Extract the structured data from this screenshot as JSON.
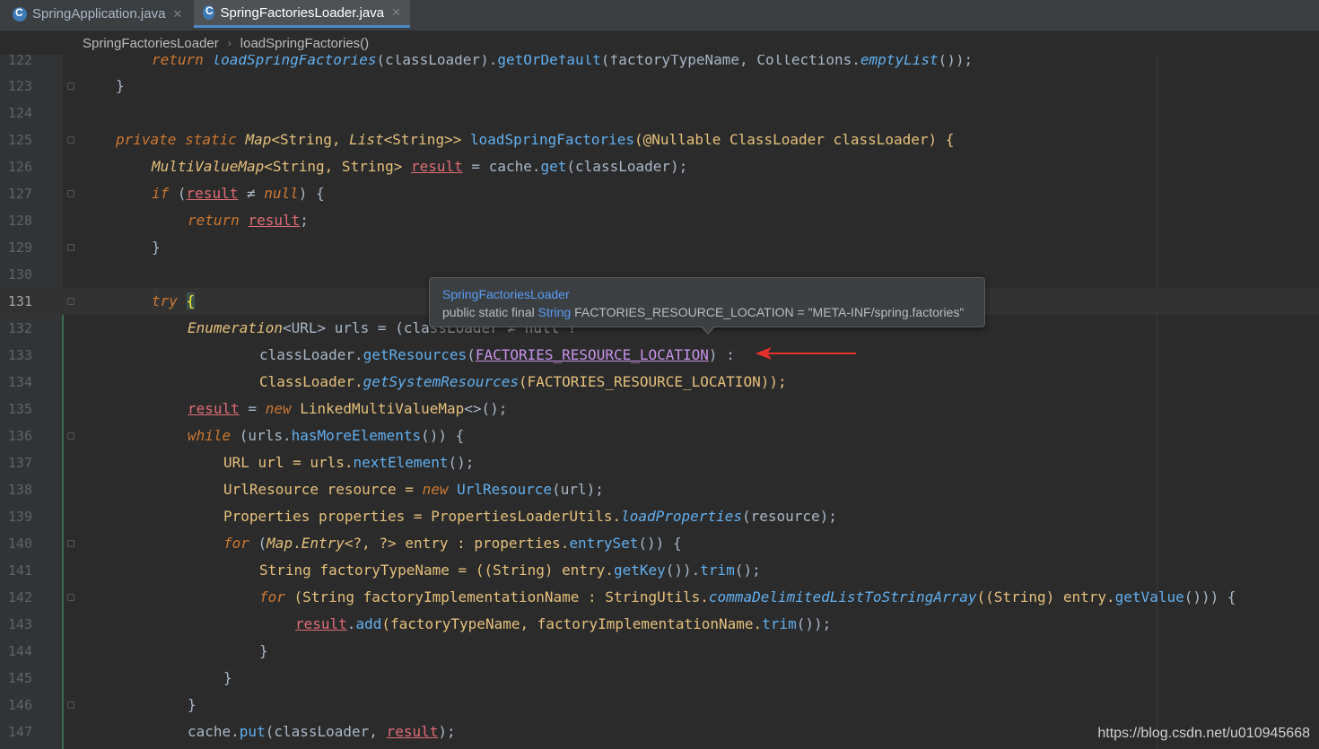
{
  "tabs": [
    {
      "label": "SpringApplication.java",
      "active": false
    },
    {
      "label": "SpringFactoriesLoader.java",
      "active": true
    }
  ],
  "breadcrumb": [
    "SpringFactoriesLoader",
    "loadSpringFactories()"
  ],
  "line_numbers": [
    "122",
    "123",
    "124",
    "125",
    "126",
    "127",
    "128",
    "129",
    "130",
    "131",
    "132",
    "133",
    "134",
    "135",
    "136",
    "137",
    "138",
    "139",
    "140",
    "141",
    "142",
    "143",
    "144",
    "145",
    "146",
    "147"
  ],
  "current_line": "131",
  "code": {
    "l122": {
      "p1": "return ",
      "p2": "loadSpringFactories",
      "p3": "(classLoader).",
      "p4": "getOrDefault",
      "p5": "(factoryTypeName, Collections.",
      "p6": "emptyList",
      "p7": "());"
    },
    "l123": {
      "p1": "}"
    },
    "l125": {
      "p1": "private static ",
      "p2": "Map",
      "p3": "<String, ",
      "p4": "List",
      "p5": "<String>> ",
      "p6": "loadSpringFactories",
      "p7": "(@Nullable ClassLoader classLoader) {"
    },
    "l126": {
      "p1": "MultiValueMap",
      "p2": "<String, String> ",
      "p3": "result",
      "p4": " = cache.",
      "p5": "get",
      "p6": "(classLoader);"
    },
    "l127": {
      "p1": "if ",
      "p2": "(",
      "p3": "result",
      "p4": " ≠ ",
      "p5": "null",
      "p6": ") {"
    },
    "l128": {
      "p1": "return ",
      "p2": "result",
      "p3": ";"
    },
    "l129": {
      "p1": "}"
    },
    "l131": {
      "p1": "try ",
      "p2": "{"
    },
    "l132": {
      "p1": "Enumeration",
      "p2": "<URL> urls = (cla",
      "p3": "ssLoader ≠ null ?"
    },
    "l133": {
      "p1": "classLoader.",
      "p2": "getResources",
      "p3": "(",
      "p4": "FACTORIES_RESOURCE_LOCATION",
      "p5": ") :"
    },
    "l134": {
      "p1": "ClassLoader.",
      "p2": "getSystemResources",
      "p3": "(FACTORIES_RESOURCE_LOCATION));"
    },
    "l135": {
      "p1": "result",
      "p2": " = ",
      "p3": "new ",
      "p4": "LinkedMultiValueMap",
      "p5": "<>();"
    },
    "l136": {
      "p1": "while ",
      "p2": "(urls.",
      "p3": "hasMoreElements",
      "p4": "()) {"
    },
    "l137": {
      "p1": "URL url = urls.",
      "p2": "nextElement",
      "p3": "();"
    },
    "l138": {
      "p1": "UrlResource resource = ",
      "p2": "new ",
      "p3": "UrlResource",
      "p4": "(url);"
    },
    "l139": {
      "p1": "Properties properties = PropertiesLoaderUtils.",
      "p2": "loadProperties",
      "p3": "(resource);"
    },
    "l140": {
      "p1": "for ",
      "p2": "(",
      "p3": "Map",
      "p4": ".",
      "p5": "Entry",
      "p6": "<?, ?> entry : properties.",
      "p7": "entrySet",
      "p8": "()) {"
    },
    "l141": {
      "p1": "String factoryTypeName = ((String) entry.",
      "p2": "getKey",
      "p3": "()).",
      "p4": "trim",
      "p5": "();"
    },
    "l142": {
      "p1": "for ",
      "p2": "(String factoryImplementationName : StringUtils.",
      "p3": "commaDelimitedListToStringArray",
      "p4": "((String) entry.",
      "p5": "getValue",
      "p6": "())) {"
    },
    "l143": {
      "p1": "result",
      "p2": ".",
      "p3": "add",
      "p4": "(factoryTypeName, factoryImplementationName.",
      "p5": "trim",
      "p6": "());"
    },
    "l144": {
      "p1": "}"
    },
    "l145": {
      "p1": "}"
    },
    "l146": {
      "p1": "}"
    },
    "l147": {
      "p1": "cache.",
      "p2": "put",
      "p3": "(classLoader, ",
      "p4": "result",
      "p5": ");"
    }
  },
  "tooltip": {
    "class_name": "SpringFactoriesLoader",
    "decl_prefix": "public static final ",
    "decl_type": "String",
    "decl_rest": " FACTORIES_RESOURCE_LOCATION = \"META-INF/spring.factories\""
  },
  "watermark": "https://blog.csdn.net/u010945668",
  "colors": {
    "keyword": "#cc7832",
    "method": "#61afef",
    "field_purple": "#e06c75",
    "annotation_arrow": "#e8312a",
    "change_marker": "#3d6a4e"
  },
  "icons": {
    "tab_file": "java-class-icon",
    "tab_close": "close-icon",
    "breadcrumb_separator": "chevron-right-icon"
  }
}
